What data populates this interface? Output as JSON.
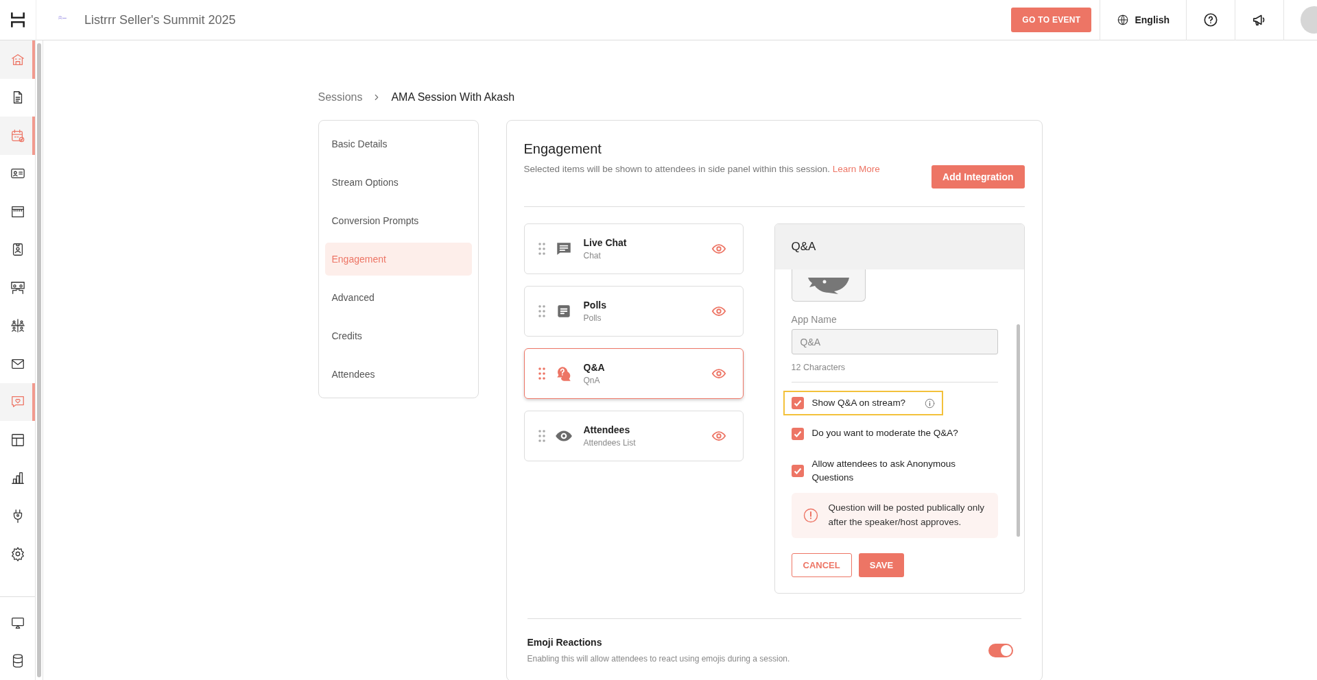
{
  "topbar": {
    "event_title": "Listrrr Seller's Summit 2025",
    "go_button": "GO TO EVENT",
    "language": "English"
  },
  "sidebar": {
    "items": [
      {
        "selected": true
      },
      {
        "selected": false
      },
      {
        "selected": true
      },
      {
        "selected": false
      },
      {
        "selected": false
      },
      {
        "selected": false
      },
      {
        "selected": false
      },
      {
        "selected": false
      },
      {
        "selected": false
      },
      {
        "selected": true
      },
      {
        "selected": false
      },
      {
        "selected": false
      },
      {
        "selected": false
      },
      {
        "selected": false
      },
      {
        "selected": false
      },
      {
        "selected": false
      }
    ]
  },
  "breadcrumb": [
    "Sessions",
    "AMA Session With Akash"
  ],
  "section_nav": {
    "items": [
      {
        "label": "Basic Details",
        "selected": false
      },
      {
        "label": "Stream Options",
        "selected": false
      },
      {
        "label": "Conversion Prompts",
        "selected": false
      },
      {
        "label": "Engagement",
        "selected": true
      },
      {
        "label": "Advanced",
        "selected": false
      },
      {
        "label": "Credits",
        "selected": false
      },
      {
        "label": "Attendees",
        "selected": false
      }
    ]
  },
  "engagement": {
    "title": "Engagement",
    "description": "Selected items will be shown to attendees in side panel within this session.",
    "learn_more": "Learn More",
    "add_button": "Add Integration",
    "apps": [
      {
        "name": "Live Chat",
        "subtitle": "Chat",
        "selected": false
      },
      {
        "name": "Polls",
        "subtitle": "Polls",
        "selected": false
      },
      {
        "name": "Q&A",
        "subtitle": "QnA",
        "selected": true
      },
      {
        "name": "Attendees",
        "subtitle": "Attendees List",
        "selected": false
      }
    ],
    "detail": {
      "title": "Q&A",
      "app_name_label": "App Name",
      "app_name_value": "Q&A",
      "char_count": "12 Characters",
      "options": [
        {
          "label": "Show Q&A on stream?",
          "checked": true,
          "highlighted": true
        },
        {
          "label": "Do you want to moderate the Q&A?",
          "checked": true,
          "highlighted": false
        },
        {
          "label": "Allow attendees to ask Anonymous Questions",
          "checked": true,
          "highlighted": false
        }
      ],
      "notice": "Question will be posted publically only after the speaker/host approves.",
      "cancel": "CANCEL",
      "save": "SAVE"
    },
    "emoji_reactions": {
      "title": "Emoji Reactions",
      "description": "Enabling this will allow attendees to react using emojis during a session.",
      "on": true
    }
  }
}
